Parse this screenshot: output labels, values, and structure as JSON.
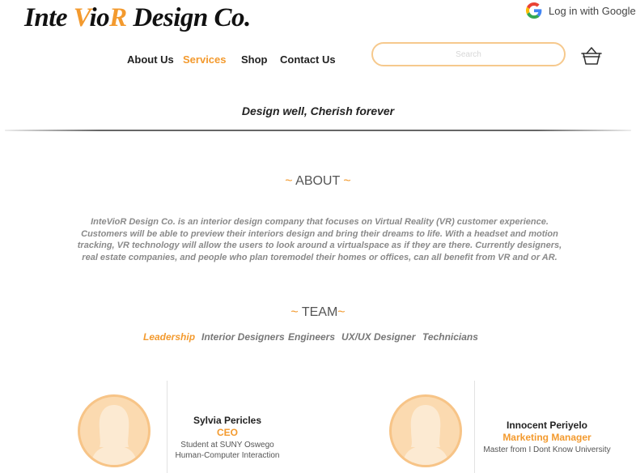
{
  "brand": {
    "logo_part1": "Inte ",
    "logo_highlight1": "V",
    "logo_part2": "io",
    "logo_highlight2": "R",
    "logo_part3": " Design Co.",
    "accent_color": "#f39a2e"
  },
  "auth": {
    "google_login_label": "Log in with Google",
    "icon": "google-icon"
  },
  "nav": {
    "items": [
      {
        "label": "About Us"
      },
      {
        "label": "Services"
      },
      {
        "label": "Shop"
      },
      {
        "label": "Contact Us"
      }
    ],
    "active": "Services"
  },
  "search": {
    "placeholder": "Search",
    "value": ""
  },
  "cart": {
    "icon": "basket-icon"
  },
  "tagline": "Design well, Cherish forever",
  "about": {
    "title": "ABOUT",
    "tilde_left": "~ ",
    "tilde_right": " ~",
    "text": "InteVioR Design Co. is an interior design company that focuses on Virtual Reality (VR) customer experience. Customers will be able to preview their interiors design and bring their dreams to life. With a headset and motion tracking, VR technology will allow the users to look around a virtualspace as if they are there. Currently designers, real estate companies, and people who plan toremodel their homes or offices, can all benefit from VR and or AR."
  },
  "team": {
    "title": "TEAM",
    "tilde_left": "~ ",
    "tilde_right": "~",
    "tabs": [
      {
        "label": "Leadership"
      },
      {
        "label": "Interior Designers"
      },
      {
        "label": "Engineers"
      },
      {
        "label": "UX/UX Designer"
      },
      {
        "label": "Technicians"
      }
    ],
    "active_tab": "Leadership",
    "members": [
      {
        "name": "Sylvia Pericles",
        "role": "CEO",
        "details": [
          "Student at SUNY Oswego",
          "Human-Computer Interaction"
        ],
        "avatar_icon": "female-avatar-icon"
      },
      {
        "name": "Innocent Periyelo",
        "role": "Marketing Manager",
        "details": [
          "Master from I Dont Know University"
        ],
        "avatar_icon": "female-avatar-icon"
      }
    ]
  }
}
